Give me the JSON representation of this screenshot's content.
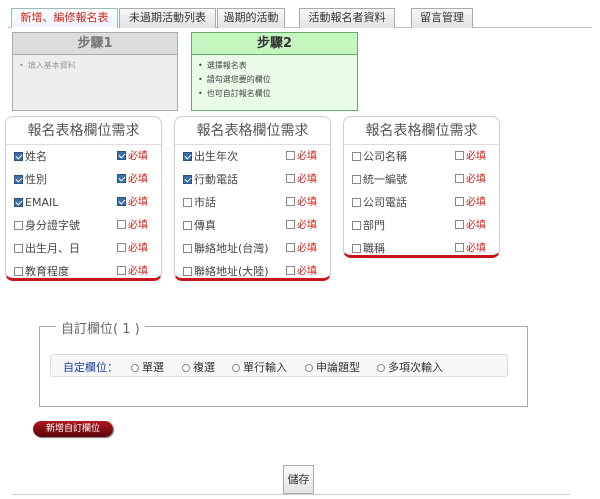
{
  "tabs": [
    {
      "label": "新增、編修報名表",
      "active": true
    },
    {
      "label": "未過期活動列表",
      "active": false
    },
    {
      "label": "過期的活動",
      "active": false
    },
    {
      "label": "活動報名者資料",
      "active": false
    },
    {
      "label": "留言管理",
      "active": false
    }
  ],
  "steps": [
    {
      "title": "步驟1",
      "items": [
        "填入基本資料"
      ]
    },
    {
      "title": "步驟2",
      "items": [
        "選擇報名表",
        "請勾選您要的欄位",
        "也可自訂報名欄位"
      ]
    }
  ],
  "field_groups": [
    {
      "title": "報名表格欄位需求",
      "rows": [
        {
          "label": "姓名",
          "checked": true,
          "required": true
        },
        {
          "label": "性別",
          "checked": true,
          "required": true
        },
        {
          "label": "EMAIL",
          "checked": true,
          "required": true
        },
        {
          "label": "身分證字號",
          "checked": false,
          "required": false
        },
        {
          "label": "出生月、日",
          "checked": false,
          "required": false
        },
        {
          "label": "教育程度",
          "checked": false,
          "required": false
        }
      ]
    },
    {
      "title": "報名表格欄位需求",
      "rows": [
        {
          "label": "出生年次",
          "checked": true,
          "required": false
        },
        {
          "label": "行動電話",
          "checked": true,
          "required": false
        },
        {
          "label": "市話",
          "checked": false,
          "required": false
        },
        {
          "label": "傳真",
          "checked": false,
          "required": false
        },
        {
          "label": "聯絡地址(台灣)",
          "checked": false,
          "required": false
        },
        {
          "label": "聯絡地址(大陸)",
          "checked": false,
          "required": false
        }
      ]
    },
    {
      "title": "報名表格欄位需求",
      "rows": [
        {
          "label": "公司名稱",
          "checked": false,
          "required": false
        },
        {
          "label": "統一編號",
          "checked": false,
          "required": false
        },
        {
          "label": "公司電話",
          "checked": false,
          "required": false
        },
        {
          "label": "部門",
          "checked": false,
          "required": false
        },
        {
          "label": "職稱",
          "checked": false,
          "required": false
        }
      ]
    }
  ],
  "required_label": "必填",
  "custom": {
    "legend": "自訂欄位( 1 )",
    "label": "自定欄位：",
    "options": [
      "單選",
      "複選",
      "單行輸入",
      "申論題型",
      "多項次輸入"
    ]
  },
  "add_button": "新增自訂欄位",
  "save_button": "儲存",
  "colors": {
    "accent_red": "#c8141e",
    "step_active_bg": "#c6f6c0",
    "custom_label": "#1a3e9e"
  }
}
